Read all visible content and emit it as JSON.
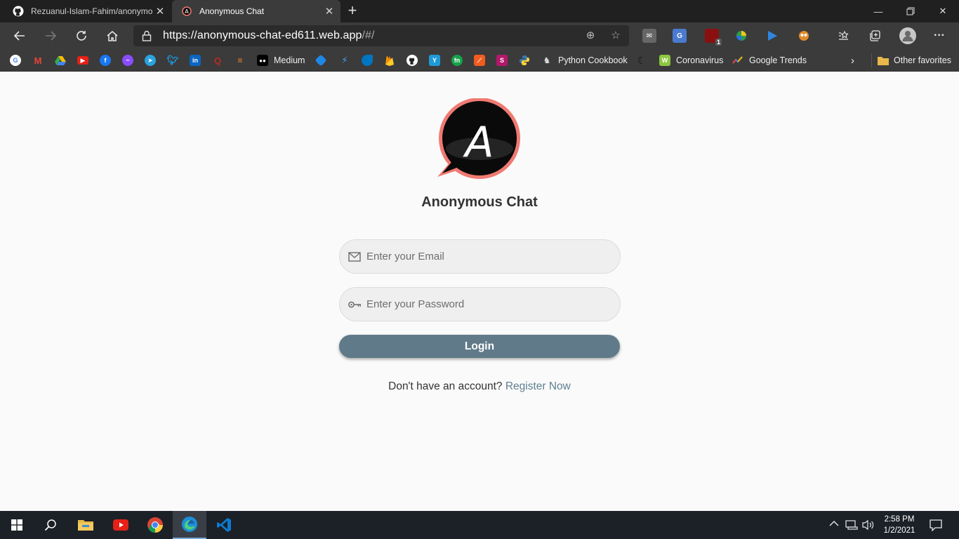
{
  "browser": {
    "tabs": [
      {
        "title": "Rezuanul-Islam-Fahim/anonymous-chat",
        "favicon": "github-icon",
        "active": false
      },
      {
        "title": "Anonymous Chat",
        "favicon": "anonymous-chat-icon",
        "active": true
      }
    ],
    "new_tab_label": "+",
    "url_main": "https://anonymous-chat-ed611.web.app",
    "url_tail": "/#/",
    "bookmarks": [
      {
        "label": "",
        "icon": "google-icon"
      },
      {
        "label": "",
        "icon": "gmail-icon"
      },
      {
        "label": "",
        "icon": "google-drive-icon"
      },
      {
        "label": "",
        "icon": "youtube-icon"
      },
      {
        "label": "",
        "icon": "facebook-icon"
      },
      {
        "label": "",
        "icon": "messenger-icon"
      },
      {
        "label": "",
        "icon": "telegram-icon"
      },
      {
        "label": "",
        "icon": "twitter-icon"
      },
      {
        "label": "",
        "icon": "linkedin-icon"
      },
      {
        "label": "",
        "icon": "quora-icon"
      },
      {
        "label": "",
        "icon": "stackoverflow-icon"
      },
      {
        "label": "Medium",
        "icon": "medium-icon"
      },
      {
        "label": "",
        "icon": "dart-icon"
      },
      {
        "label": "",
        "icon": "flutter-icon"
      },
      {
        "label": "",
        "icon": "dart-icon"
      },
      {
        "label": "",
        "icon": "firebase-icon"
      },
      {
        "label": "",
        "icon": "github-icon"
      },
      {
        "label": "",
        "icon": "bookmark-y-icon"
      },
      {
        "label": "",
        "icon": "bookmark-fn-icon"
      },
      {
        "label": "",
        "icon": "bookmark-orange-icon"
      },
      {
        "label": "",
        "icon": "bookmark-s-icon"
      },
      {
        "label": "",
        "icon": "python-icon"
      },
      {
        "label": "Python Cookbook",
        "icon": "python-cookbook-icon"
      },
      {
        "label": "",
        "icon": "moon-icon"
      },
      {
        "label": "Coronavirus",
        "icon": "coronavirus-icon"
      },
      {
        "label": "Google Trends",
        "icon": "google-trends-icon"
      }
    ],
    "other_favorites": "Other favorites",
    "extension_badge": "1"
  },
  "app": {
    "title": "Anonymous Chat",
    "logo_letter": "A",
    "email_placeholder": "Enter your Email",
    "password_placeholder": "Enter your Password",
    "login_label": "Login",
    "register_prompt": "Don't have an account?",
    "register_link": "Register Now",
    "colors": {
      "logo_ring": "#f07a72",
      "button": "#607a89",
      "link": "#5f7f8f"
    }
  },
  "taskbar": {
    "time": "2:58 PM",
    "date": "1/2/2021"
  }
}
